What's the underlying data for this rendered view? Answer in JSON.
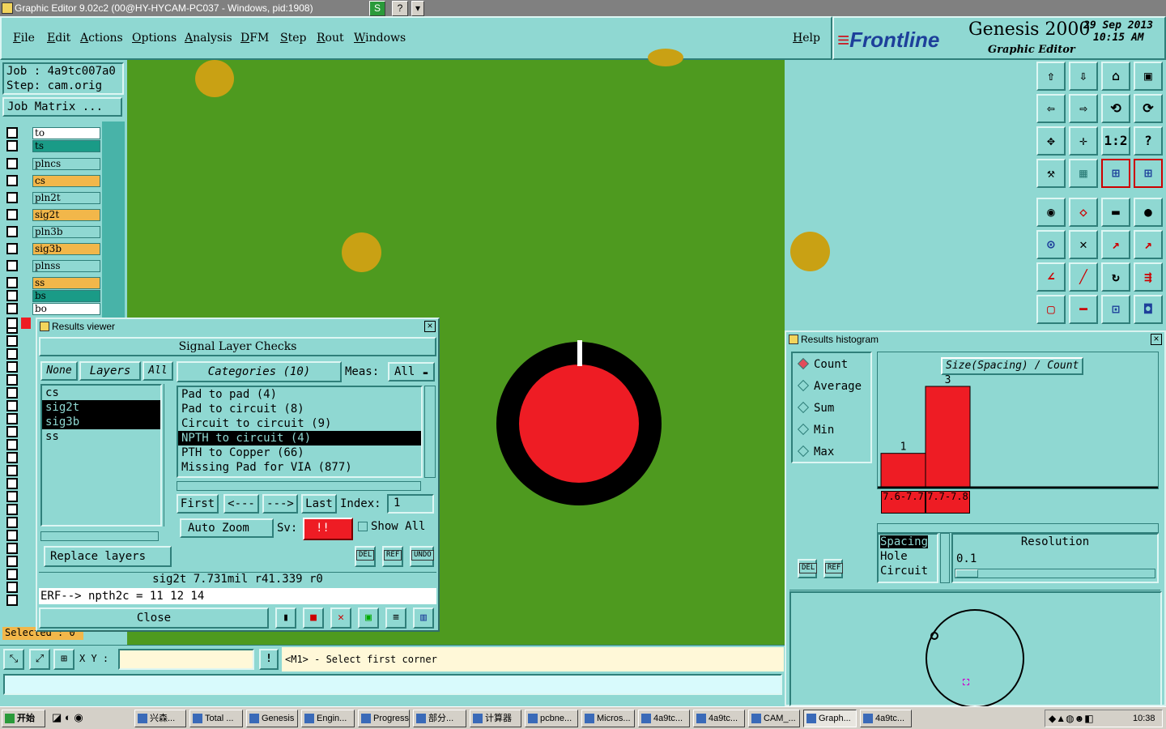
{
  "window": {
    "title": "Graphic Editor 9.02c2 (00@HY-HYCAM-PC037 - Windows, pid:1908)",
    "buttons": [
      "S",
      "?",
      "▾"
    ]
  },
  "menu": {
    "items": [
      "File",
      "Edit",
      "Actions",
      "Options",
      "Analysis",
      "DFM",
      "Step",
      "Rout",
      "Windows"
    ],
    "help": "Help"
  },
  "brand": {
    "logo": "Frontline",
    "product": "Genesis 2000",
    "subtitle": "Graphic Editor",
    "date": "29 Sep 2013",
    "time": "10:15 AM"
  },
  "job": {
    "job_label": "Job : 4a9tc007a0",
    "step_label": "Step: cam.orig",
    "matrix_button": "Job Matrix ..."
  },
  "layers": [
    {
      "name": "to",
      "color": "#ffffff"
    },
    {
      "name": "ts",
      "color": "#1a9b87"
    },
    {
      "name": "plncs",
      "color": "#8fd8d2"
    },
    {
      "name": "cs",
      "color": "#f2b74a"
    },
    {
      "name": "pln2t",
      "color": "#8fd8d2"
    },
    {
      "name": "sig2t",
      "color": "#f2b74a"
    },
    {
      "name": "pln3b",
      "color": "#8fd8d2"
    },
    {
      "name": "sig3b",
      "color": "#f2b74a"
    },
    {
      "name": "plnss",
      "color": "#8fd8d2"
    },
    {
      "name": "ss",
      "color": "#f2b74a"
    },
    {
      "name": "bs",
      "color": "#1a9b87"
    },
    {
      "name": "bo",
      "color": "#ffffff"
    }
  ],
  "selected_label": "Selected : 0",
  "results_viewer": {
    "title": "Results viewer",
    "header": "Signal Layer Checks",
    "layer_buttons": {
      "none": "None",
      "layers": "Layers",
      "all": "All"
    },
    "layers": [
      "cs",
      "sig2t",
      "sig3b",
      "ss"
    ],
    "categories_label": "Categories (10)",
    "meas_label": "Meas:",
    "meas_value": "All",
    "categories": [
      "Pad to pad (4)",
      "Pad to circuit (8)",
      "Circuit to circuit (9)",
      "NPTH to circuit (4)",
      "PTH to Copper (66)",
      "Missing Pad for VIA (877)"
    ],
    "selected_category": 3,
    "nav": {
      "first": "First",
      "prev": "<---",
      "next": "--->",
      "last": "Last",
      "index_label": "Index:",
      "index_value": "1"
    },
    "auto_zoom": "Auto Zoom",
    "sv_label": "Sv:",
    "sv_value": "!!",
    "show_all": "Show All",
    "replace_layers": "Replace layers",
    "small_buttons": [
      "DEL",
      "REF",
      "UNDO"
    ],
    "status": "sig2t 7.731mil  r41.339  r0",
    "erf": "ERF--> npth2c = 11 12 14",
    "close": "Close"
  },
  "histogram": {
    "title": "Results histogram",
    "modes": [
      "Count",
      "Average",
      "Sum",
      "Min",
      "Max"
    ],
    "selected_mode": "Count",
    "chart_title": "Size(Spacing) / Count",
    "chart_data": {
      "type": "bar",
      "categories": [
        "7.6-7.7",
        "7.7-7.8"
      ],
      "values": [
        1,
        3
      ],
      "title": "Size(Spacing) / Count",
      "ylim": [
        0,
        3
      ]
    },
    "size_types": [
      "Spacing",
      "Hole",
      "Circuit"
    ],
    "resolution_label": "Resolution",
    "resolution_value": "0.1",
    "small_buttons": [
      "DEL",
      "REF"
    ]
  },
  "coord": {
    "xy_label": "X Y :",
    "prompt": "<M1> - Select first corner"
  },
  "taskbar": {
    "start": "开始",
    "tasks": [
      "兴森...",
      "Total ...",
      "Genesis",
      "Engin...",
      "Progress",
      "部分...",
      "计算器",
      "pcbne...",
      "Micros...",
      "4a9tc...",
      "4a9tc...",
      "CAM_...",
      "Graph...",
      "4a9tc..."
    ],
    "clock": "10:38"
  },
  "tools": [
    "⇧",
    "⇩",
    "⌂",
    "▣",
    "⇦",
    "⇨",
    "⟲",
    "⟳",
    "✥",
    "✛",
    "1:2",
    "?",
    "⚒",
    "▦",
    "⊞",
    "⊞",
    "◉",
    "◇",
    "▬",
    "●",
    "⊙",
    "✕",
    "↗",
    "↗",
    "∠",
    "╱",
    "↻",
    "⇶",
    "▢",
    "━",
    "⊡",
    "◘"
  ]
}
